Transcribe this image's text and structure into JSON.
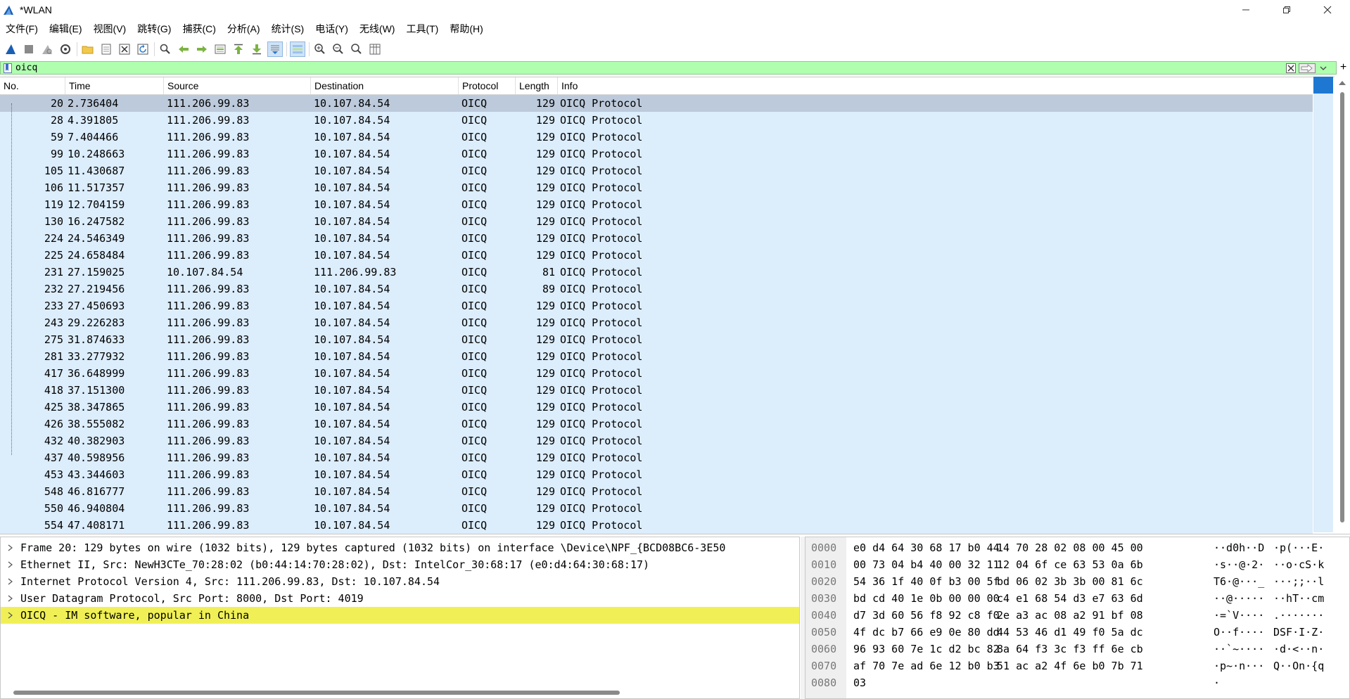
{
  "window": {
    "title": "*WLAN"
  },
  "menu": [
    "文件(F)",
    "编辑(E)",
    "视图(V)",
    "跳转(G)",
    "捕获(C)",
    "分析(A)",
    "统计(S)",
    "电话(Y)",
    "无线(W)",
    "工具(T)",
    "帮助(H)"
  ],
  "toolbar_icons": [
    "shark-fin-start-icon",
    "stop-square-icon",
    "restart-fin-icon",
    "capture-options-gear-icon",
    "open-folder-icon",
    "save-file-icon",
    "close-file-icon",
    "reload-icon",
    "find-magnifier-icon",
    "back-arrow-icon",
    "forward-arrow-icon",
    "goto-packet-icon",
    "first-packet-icon",
    "last-packet-icon",
    "autoscroll-icon",
    "colorize-icon",
    "zoom-in-icon",
    "zoom-out-icon",
    "normal-size-icon",
    "resize-columns-icon"
  ],
  "filter": {
    "value": "oicq"
  },
  "packet_list": {
    "columns": [
      "No.",
      "Time",
      "Source",
      "Destination",
      "Protocol",
      "Length",
      "Info"
    ],
    "rows": [
      {
        "no": "20",
        "time": "2.736404",
        "src": "111.206.99.83",
        "dst": "10.107.84.54",
        "proto": "OICQ",
        "len": "129",
        "info": "OICQ Protocol"
      },
      {
        "no": "28",
        "time": "4.391805",
        "src": "111.206.99.83",
        "dst": "10.107.84.54",
        "proto": "OICQ",
        "len": "129",
        "info": "OICQ Protocol"
      },
      {
        "no": "59",
        "time": "7.404466",
        "src": "111.206.99.83",
        "dst": "10.107.84.54",
        "proto": "OICQ",
        "len": "129",
        "info": "OICQ Protocol"
      },
      {
        "no": "99",
        "time": "10.248663",
        "src": "111.206.99.83",
        "dst": "10.107.84.54",
        "proto": "OICQ",
        "len": "129",
        "info": "OICQ Protocol"
      },
      {
        "no": "105",
        "time": "11.430687",
        "src": "111.206.99.83",
        "dst": "10.107.84.54",
        "proto": "OICQ",
        "len": "129",
        "info": "OICQ Protocol"
      },
      {
        "no": "106",
        "time": "11.517357",
        "src": "111.206.99.83",
        "dst": "10.107.84.54",
        "proto": "OICQ",
        "len": "129",
        "info": "OICQ Protocol"
      },
      {
        "no": "119",
        "time": "12.704159",
        "src": "111.206.99.83",
        "dst": "10.107.84.54",
        "proto": "OICQ",
        "len": "129",
        "info": "OICQ Protocol"
      },
      {
        "no": "130",
        "time": "16.247582",
        "src": "111.206.99.83",
        "dst": "10.107.84.54",
        "proto": "OICQ",
        "len": "129",
        "info": "OICQ Protocol"
      },
      {
        "no": "224",
        "time": "24.546349",
        "src": "111.206.99.83",
        "dst": "10.107.84.54",
        "proto": "OICQ",
        "len": "129",
        "info": "OICQ Protocol"
      },
      {
        "no": "225",
        "time": "24.658484",
        "src": "111.206.99.83",
        "dst": "10.107.84.54",
        "proto": "OICQ",
        "len": "129",
        "info": "OICQ Protocol"
      },
      {
        "no": "231",
        "time": "27.159025",
        "src": "10.107.84.54",
        "dst": "111.206.99.83",
        "proto": "OICQ",
        "len": "81",
        "info": "OICQ Protocol"
      },
      {
        "no": "232",
        "time": "27.219456",
        "src": "111.206.99.83",
        "dst": "10.107.84.54",
        "proto": "OICQ",
        "len": "89",
        "info": "OICQ Protocol"
      },
      {
        "no": "233",
        "time": "27.450693",
        "src": "111.206.99.83",
        "dst": "10.107.84.54",
        "proto": "OICQ",
        "len": "129",
        "info": "OICQ Protocol"
      },
      {
        "no": "243",
        "time": "29.226283",
        "src": "111.206.99.83",
        "dst": "10.107.84.54",
        "proto": "OICQ",
        "len": "129",
        "info": "OICQ Protocol"
      },
      {
        "no": "275",
        "time": "31.874633",
        "src": "111.206.99.83",
        "dst": "10.107.84.54",
        "proto": "OICQ",
        "len": "129",
        "info": "OICQ Protocol"
      },
      {
        "no": "281",
        "time": "33.277932",
        "src": "111.206.99.83",
        "dst": "10.107.84.54",
        "proto": "OICQ",
        "len": "129",
        "info": "OICQ Protocol"
      },
      {
        "no": "417",
        "time": "36.648999",
        "src": "111.206.99.83",
        "dst": "10.107.84.54",
        "proto": "OICQ",
        "len": "129",
        "info": "OICQ Protocol"
      },
      {
        "no": "418",
        "time": "37.151300",
        "src": "111.206.99.83",
        "dst": "10.107.84.54",
        "proto": "OICQ",
        "len": "129",
        "info": "OICQ Protocol"
      },
      {
        "no": "425",
        "time": "38.347865",
        "src": "111.206.99.83",
        "dst": "10.107.84.54",
        "proto": "OICQ",
        "len": "129",
        "info": "OICQ Protocol"
      },
      {
        "no": "426",
        "time": "38.555082",
        "src": "111.206.99.83",
        "dst": "10.107.84.54",
        "proto": "OICQ",
        "len": "129",
        "info": "OICQ Protocol"
      },
      {
        "no": "432",
        "time": "40.382903",
        "src": "111.206.99.83",
        "dst": "10.107.84.54",
        "proto": "OICQ",
        "len": "129",
        "info": "OICQ Protocol"
      },
      {
        "no": "437",
        "time": "40.598956",
        "src": "111.206.99.83",
        "dst": "10.107.84.54",
        "proto": "OICQ",
        "len": "129",
        "info": "OICQ Protocol"
      },
      {
        "no": "453",
        "time": "43.344603",
        "src": "111.206.99.83",
        "dst": "10.107.84.54",
        "proto": "OICQ",
        "len": "129",
        "info": "OICQ Protocol"
      },
      {
        "no": "548",
        "time": "46.816777",
        "src": "111.206.99.83",
        "dst": "10.107.84.54",
        "proto": "OICQ",
        "len": "129",
        "info": "OICQ Protocol"
      },
      {
        "no": "550",
        "time": "46.940804",
        "src": "111.206.99.83",
        "dst": "10.107.84.54",
        "proto": "OICQ",
        "len": "129",
        "info": "OICQ Protocol"
      },
      {
        "no": "554",
        "time": "47.408171",
        "src": "111.206.99.83",
        "dst": "10.107.84.54",
        "proto": "OICQ",
        "len": "129",
        "info": "OICQ Protocol"
      }
    ]
  },
  "details": [
    "Frame 20: 129 bytes on wire (1032 bits), 129 bytes captured (1032 bits) on interface \\Device\\NPF_{BCD08BC6-3E50",
    "Ethernet II, Src: NewH3CTe_70:28:02 (b0:44:14:70:28:02), Dst: IntelCor_30:68:17 (e0:d4:64:30:68:17)",
    "Internet Protocol Version 4, Src: 111.206.99.83, Dst: 10.107.84.54",
    "User Datagram Protocol, Src Port: 8000, Dst Port: 4019",
    "OICQ - IM software, popular in China"
  ],
  "bytes": [
    {
      "off": "0000",
      "hex1": "e0 d4 64 30 68 17 b0 44",
      "hex2": "14 70 28 02 08 00 45 00",
      "asc1": "··d0h··D",
      "asc2": "·p(···E·"
    },
    {
      "off": "0010",
      "hex1": "00 73 04 b4 40 00 32 11",
      "hex2": "12 04 6f ce 63 53 0a 6b",
      "asc1": "·s··@·2·",
      "asc2": "··o·cS·k"
    },
    {
      "off": "0020",
      "hex1": "54 36 1f 40 0f b3 00 5f",
      "hex2": "bd 06 02 3b 3b 00 81 6c",
      "asc1": "T6·@···_",
      "asc2": "···;;··l"
    },
    {
      "off": "0030",
      "hex1": "bd cd 40 1e 0b 00 00 00",
      "hex2": "c4 e1 68 54 d3 e7 63 6d",
      "asc1": "··@·····",
      "asc2": "··hT··cm"
    },
    {
      "off": "0040",
      "hex1": "d7 3d 60 56 f8 92 c8 f0",
      "hex2": "2e a3 ac 08 a2 91 bf 08",
      "asc1": "·=`V····",
      "asc2": ".·······"
    },
    {
      "off": "0050",
      "hex1": "4f dc b7 66 e9 0e 80 dd",
      "hex2": "44 53 46 d1 49 f0 5a dc",
      "asc1": "O··f····",
      "asc2": "DSF·I·Z·"
    },
    {
      "off": "0060",
      "hex1": "96 93 60 7e 1c d2 bc 82",
      "hex2": "8a 64 f3 3c f3 ff 6e cb",
      "asc1": "··`~····",
      "asc2": "·d·<··n·"
    },
    {
      "off": "0070",
      "hex1": "af 70 7e ad 6e 12 b0 b3",
      "hex2": "51 ac a2 4f 6e b0 7b 71",
      "asc1": "·p~·n···",
      "asc2": "Q··On·{q"
    },
    {
      "off": "0080",
      "hex1": "03",
      "hex2": "",
      "asc1": "·",
      "asc2": ""
    }
  ],
  "colors": {
    "row_bg": "#dcedfc",
    "selected_row": "#bccadb",
    "filter_ok": "#afffaf",
    "detail_highlight": "#f0f056"
  }
}
